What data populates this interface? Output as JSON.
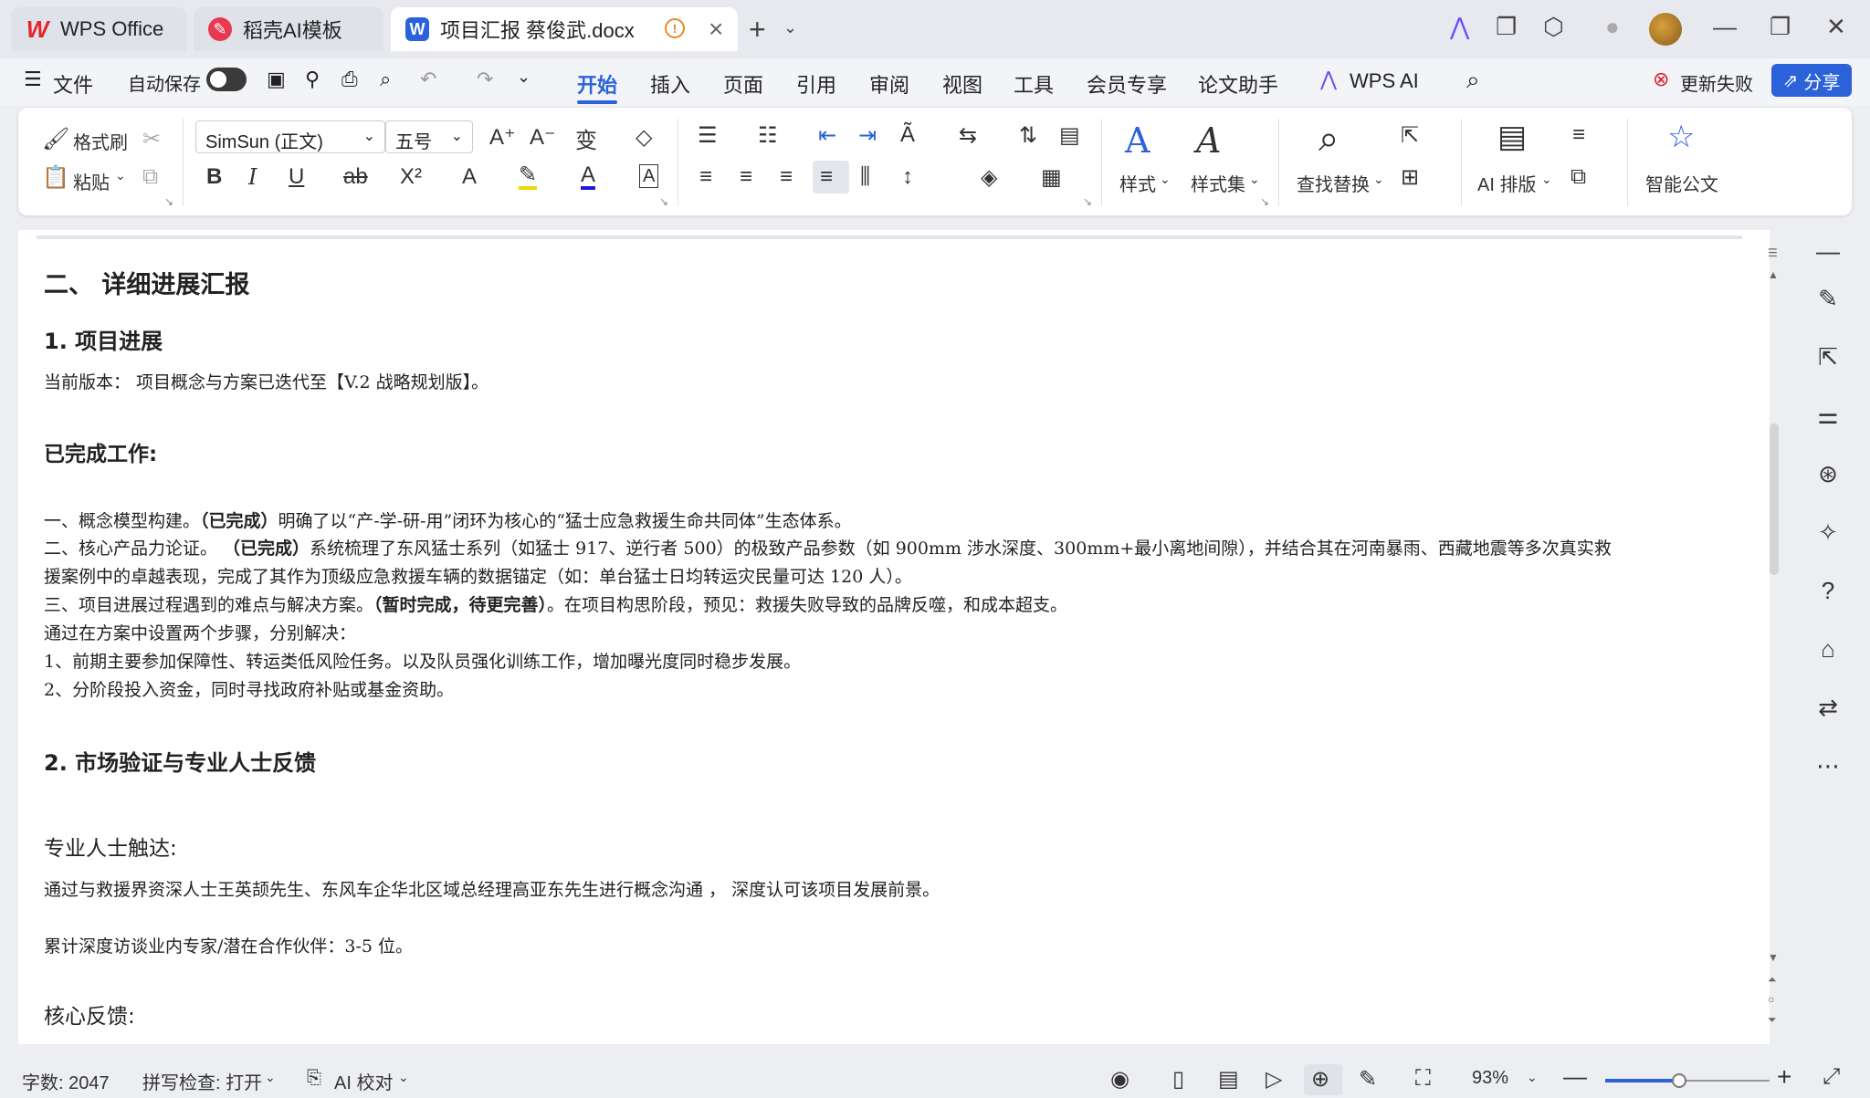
{
  "tabs": {
    "wps": "WPS Office",
    "ai_template": "稻壳AI模板",
    "doc": "项目汇报 蔡俊武.docx"
  },
  "menu": {
    "file": "文件",
    "autosave": "自动保存",
    "items": [
      "开始",
      "插入",
      "页面",
      "引用",
      "审阅",
      "视图",
      "工具",
      "会员专享",
      "论文助手"
    ],
    "wps_ai": "WPS AI",
    "update_failed": "更新失败",
    "share": "分享"
  },
  "ribbon": {
    "format_painter": "格式刷",
    "paste": "粘贴",
    "font_name": "SimSun (正文)",
    "font_size": "五号",
    "styles": "样式",
    "style_set": "样式集",
    "find_replace": "查找替换",
    "ai_layout": "AI 排版",
    "smart_doc": "智能公文"
  },
  "document": {
    "section_heading": "二、 详细进展汇报",
    "h_progress": "1. 项目进展",
    "current_version": "当前版本： 项目概念与方案已迭代至【V.2 战略规划版】。",
    "completed_title": "已完成工作:",
    "item1_pre": "一、概念模型构建。",
    "item1_bold": "（已完成）",
    "item1_post": "明确了以“产-学-研-用”闭环为核心的“猛士应急救援生命共同体”生态体系。",
    "item2_pre": "二、核心产品力论证。 ",
    "item2_bold": "（已完成）",
    "item2_post": "系统梳理了东风猛士系列（如猛士 917、逆行者 500）的极致产品参数（如 900mm 涉水深度、300mm+最小离地间隙），并结合其在河南暴雨、西藏地震等多次真实救",
    "item2_cont": "援案例中的卓越表现，完成了其作为顶级应急救援车辆的数据锚定（如：单台猛士日均转运灾民量可达 120 人）。",
    "item3_pre": "三、项目进展过程遇到的难点与解决方案。",
    "item3_bold": "（暂时完成，待更完善）",
    "item3_post": "。在项目构思阶段，预见：救援失败导致的品牌反噬，和成本超支。",
    "steps_intro": "通过在方案中设置两个步骤，分别解决：",
    "step1": "1、前期主要参加保障性、转运类低风险任务。以及队员强化训练工作，增加曝光度同时稳步发展。",
    "step2": "2、分阶段投入资金，同时寻找政府补贴或基金资助。",
    "h_market": "2. 市场验证与专业人士反馈",
    "expert_title": "专业人士触达:",
    "expert_text": "通过与救援界资深人士王英颉先生、东风车企华北区域总经理高亚东先生进行概念沟通 ， 深度认可该项目发展前景。",
    "interview_count": "累计深度访谈业内专家/潜在合作伙伴：3-5 位。",
    "feedback_title": "核心反馈:"
  },
  "status": {
    "word_count": "字数: 2047",
    "spell_check": "拼写检查: 打开",
    "ai_proofread": "AI 校对",
    "zoom": "93%",
    "zoom_level": 0.45
  },
  "colors": {
    "accent": "#2b62d9",
    "wps_red": "#e3262b",
    "warning": "#e8892b"
  }
}
